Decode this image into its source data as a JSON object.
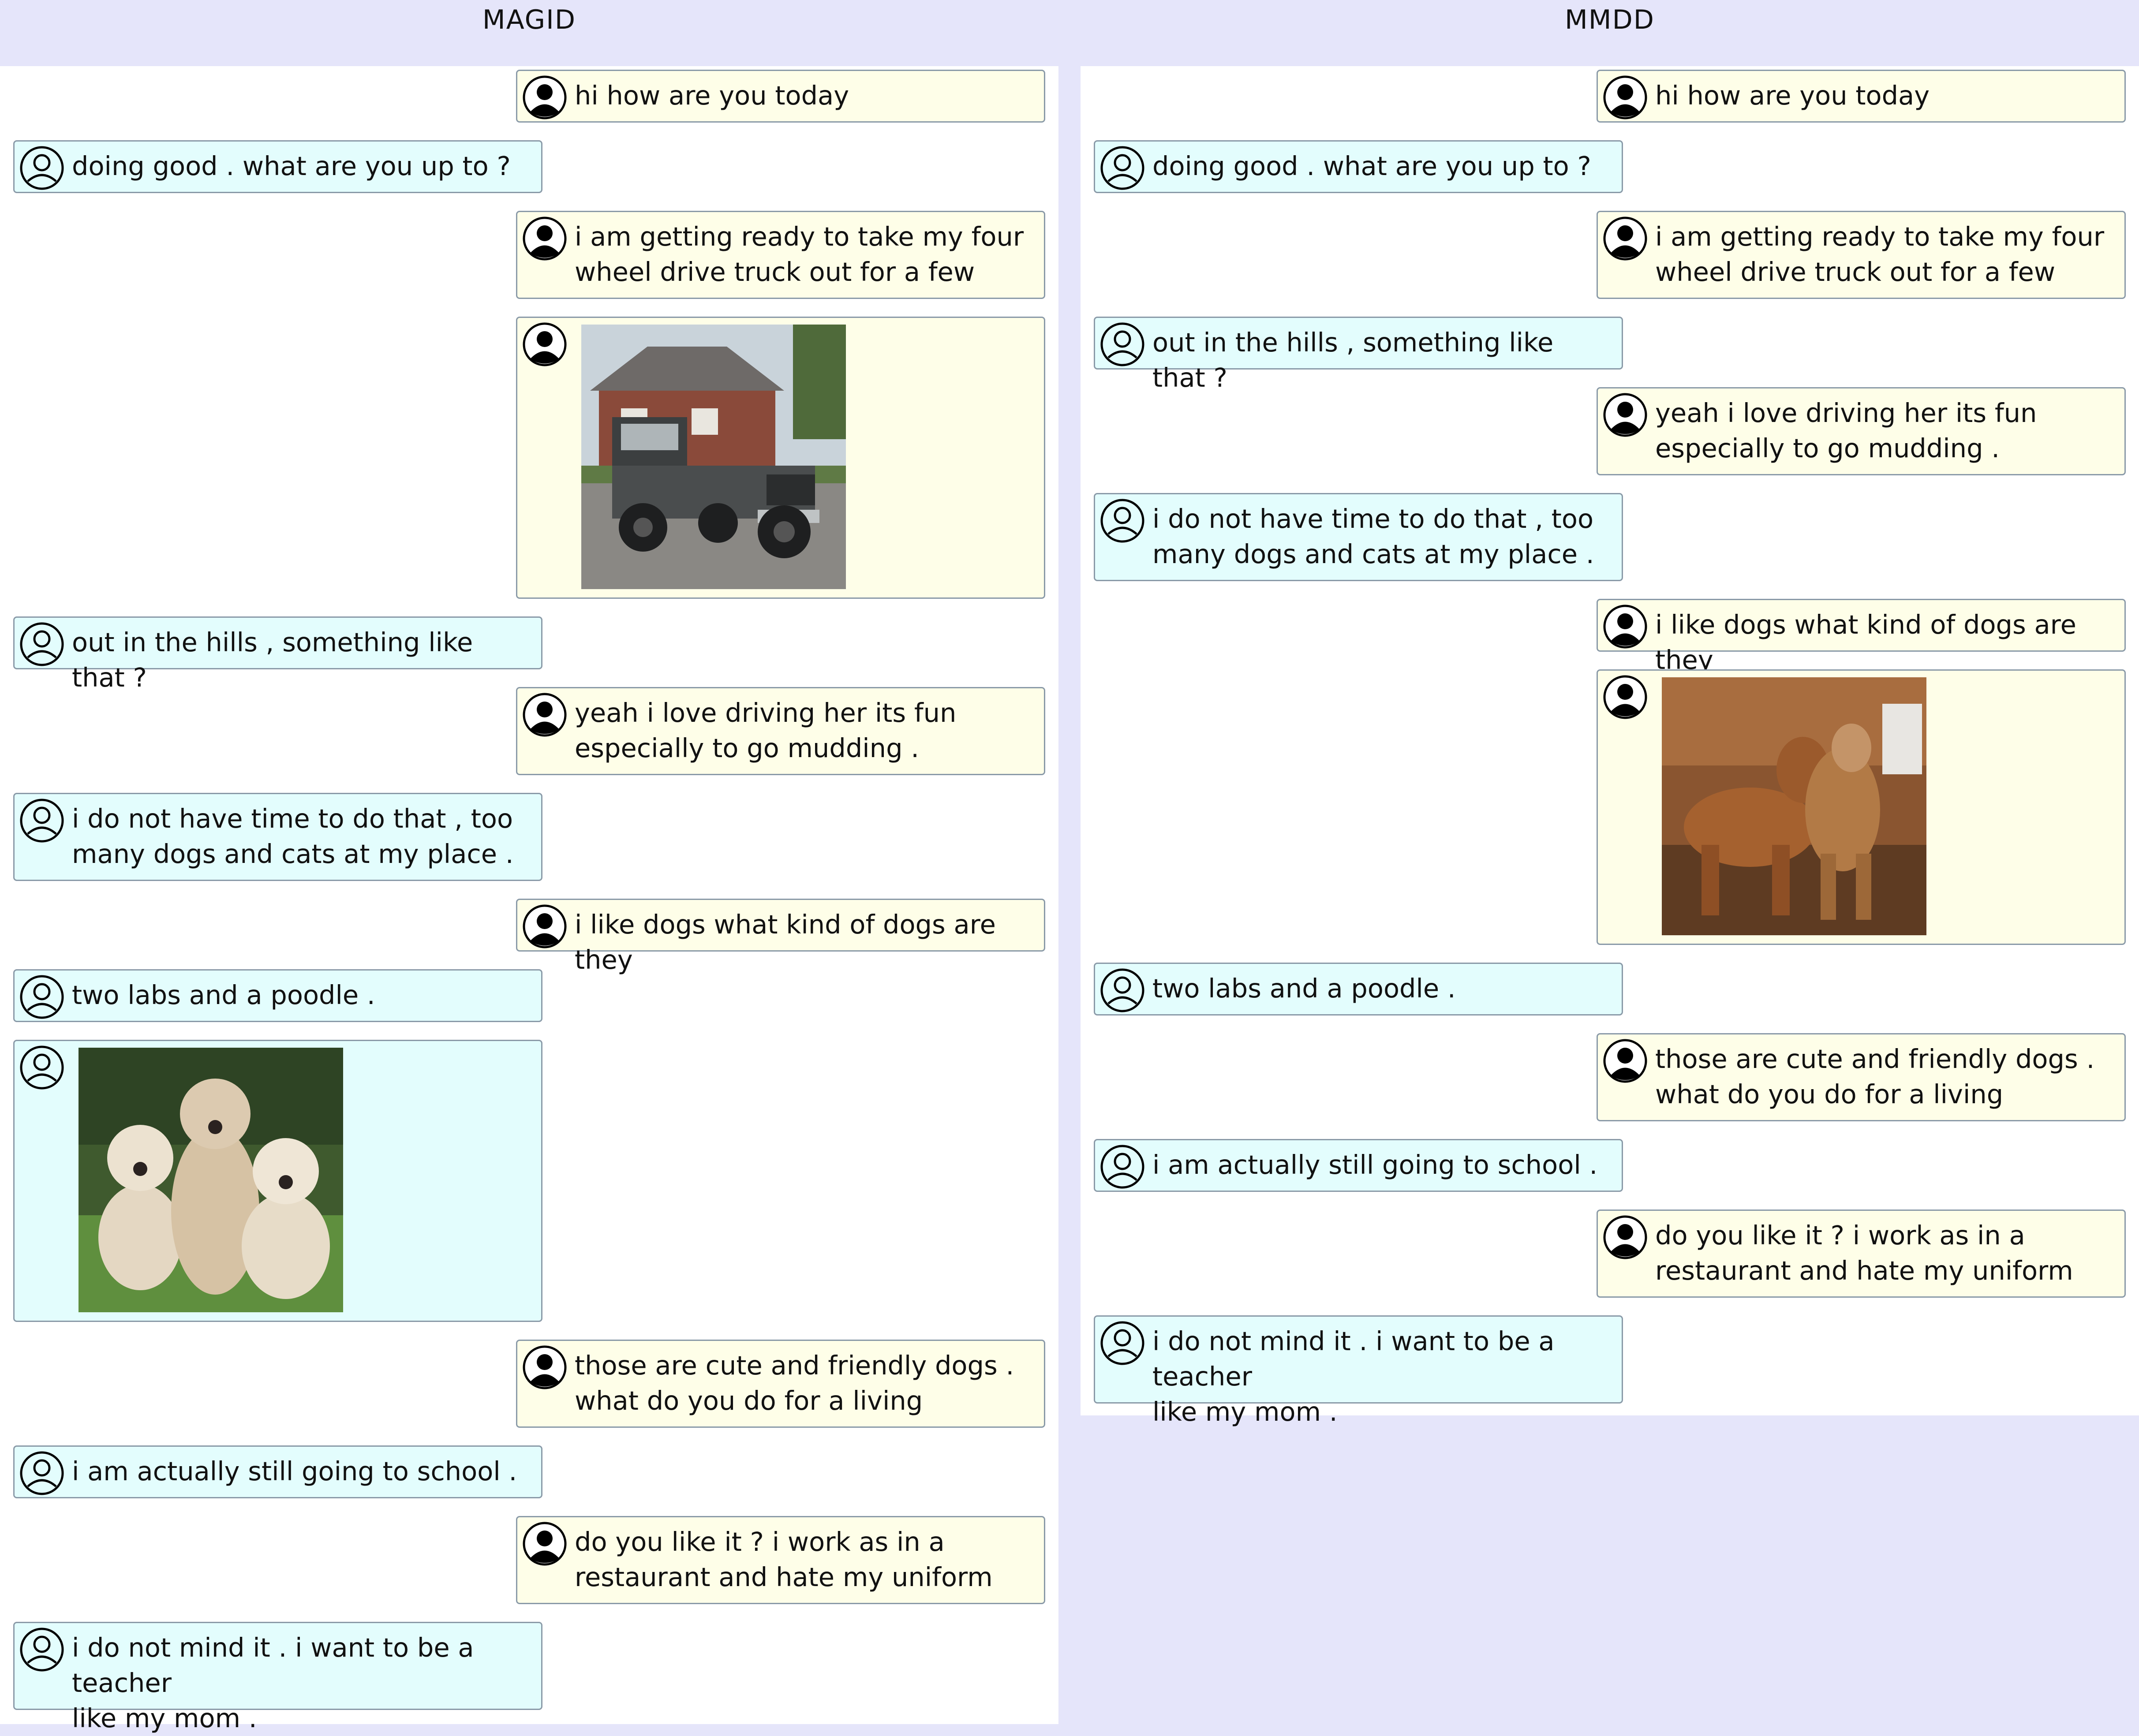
{
  "columns": {
    "left": {
      "title": "MAGID",
      "messages": [
        {
          "speaker": "user1",
          "text": "hi how are you today"
        },
        {
          "speaker": "user2",
          "text": "doing good . what are you up to ?"
        },
        {
          "speaker": "user1",
          "text": "i am getting ready to take my four\nwheel drive truck out for a few"
        },
        {
          "speaker": "user1",
          "image": "truck-photo"
        },
        {
          "speaker": "user2",
          "text": "out in the hills , something like that ?"
        },
        {
          "speaker": "user1",
          "text": "yeah i love driving her its fun\nespecially to go mudding ."
        },
        {
          "speaker": "user2",
          "text": "i do not have time to do that , too\nmany dogs and cats at my place ."
        },
        {
          "speaker": "user1",
          "text": "i like dogs what kind of dogs are they"
        },
        {
          "speaker": "user2",
          "text": "two labs and a poodle ."
        },
        {
          "speaker": "user2",
          "image": "poodles-photo"
        },
        {
          "speaker": "user1",
          "text": "those are cute and friendly dogs .\nwhat do you do for a living"
        },
        {
          "speaker": "user2",
          "text": "i am actually still going to school ."
        },
        {
          "speaker": "user1",
          "text": "do you like it ? i work as in a\nrestaurant and hate my uniform"
        },
        {
          "speaker": "user2",
          "text": "i do not mind it . i want to be a teacher\nlike my mom ."
        }
      ]
    },
    "right": {
      "title": "MMDD",
      "messages": [
        {
          "speaker": "user1",
          "text": "hi how are you today"
        },
        {
          "speaker": "user2",
          "text": "doing good . what are you up to ?"
        },
        {
          "speaker": "user1",
          "text": "i am getting ready to take my four\nwheel drive truck out for a few"
        },
        {
          "speaker": "user2",
          "text": "out in the hills , something like that ?"
        },
        {
          "speaker": "user1",
          "text": "yeah i love driving her its fun\nespecially to go mudding ."
        },
        {
          "speaker": "user2",
          "text": "i do not have time to do that , too\nmany dogs and cats at my place ."
        },
        {
          "speaker": "user1",
          "text": "i like dogs what kind of dogs are they"
        },
        {
          "speaker": "user1",
          "image": "dogs-playing-photo"
        },
        {
          "speaker": "user2",
          "text": "two labs and a poodle ."
        },
        {
          "speaker": "user1",
          "text": "those are cute and friendly dogs .\nwhat do you do for a living"
        },
        {
          "speaker": "user2",
          "text": "i am actually still going to school ."
        },
        {
          "speaker": "user1",
          "text": "do you like it ? i work as in a\nrestaurant and hate my uniform"
        },
        {
          "speaker": "user2",
          "text": "i do not mind it . i want to be a teacher\nlike my mom ."
        }
      ]
    }
  },
  "colors": {
    "background": "#e5e5fa",
    "user1_bubble": "#fefee8",
    "user2_bubble": "#e3fdfd",
    "bubble_border": "#8a9aa8"
  },
  "icons": {
    "user1": "filled-person-icon",
    "user2": "outline-person-icon"
  }
}
